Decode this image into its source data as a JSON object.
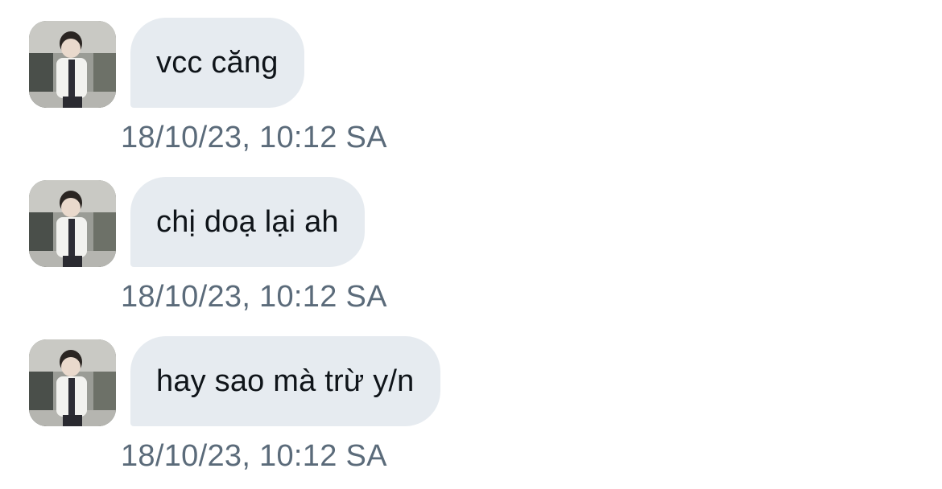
{
  "conversation": {
    "messages": [
      {
        "text": "vcc căng",
        "timestamp": "18/10/23, 10:12 SA",
        "avatar_icon": "user-avatar-photo"
      },
      {
        "text": "chị doạ lại ah",
        "timestamp": "18/10/23, 10:12 SA",
        "avatar_icon": "user-avatar-photo"
      },
      {
        "text": "hay sao mà trừ y/n",
        "timestamp": "18/10/23, 10:12 SA",
        "avatar_icon": "user-avatar-photo"
      }
    ]
  },
  "colors": {
    "bubble_background": "#e6ebf0",
    "message_text": "#0f1419",
    "timestamp_text": "#5b6b7a",
    "page_background": "#ffffff"
  }
}
